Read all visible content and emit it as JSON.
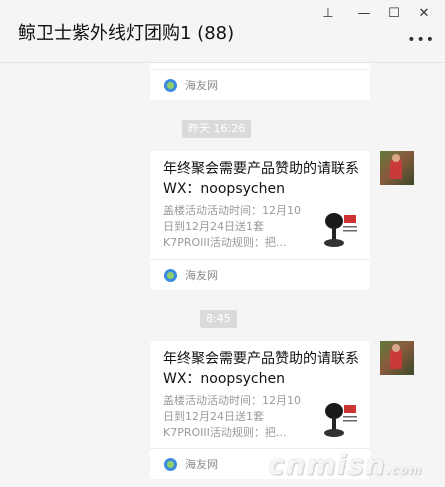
{
  "window": {
    "title": "鲸卫士紫外线灯团购1 (88)",
    "controls": {
      "pin": "⊥",
      "minimize": "—",
      "maximize": "☐",
      "close": "✕"
    },
    "more": "•••"
  },
  "messages": [
    {
      "type": "card-partial",
      "source": "海友网"
    },
    {
      "type": "time",
      "text": "昨天 16:26"
    },
    {
      "type": "card",
      "title": "年终聚会需要产品赞助的请联系WX：noopsychen",
      "description": "盖楼活动活动时间：12月10日到12月24日送1套K7PROIII活动规则：把...",
      "source": "海友网",
      "thumb_icon": "product-lamp-icon"
    },
    {
      "type": "time",
      "text": "8:45"
    },
    {
      "type": "card",
      "title": "年终聚会需要产品赞助的请联系WX：noopsychen",
      "description": "盖楼活动活动时间：12月10日到12月24日送1套K7PROIII活动规则：把...",
      "source": "海友网",
      "thumb_icon": "product-lamp-icon"
    }
  ],
  "watermark": {
    "text": "cnmisn",
    "suffix": ".com"
  },
  "colors": {
    "background": "#f5f5f5",
    "card": "#ffffff",
    "time_badge": "#dadada"
  }
}
